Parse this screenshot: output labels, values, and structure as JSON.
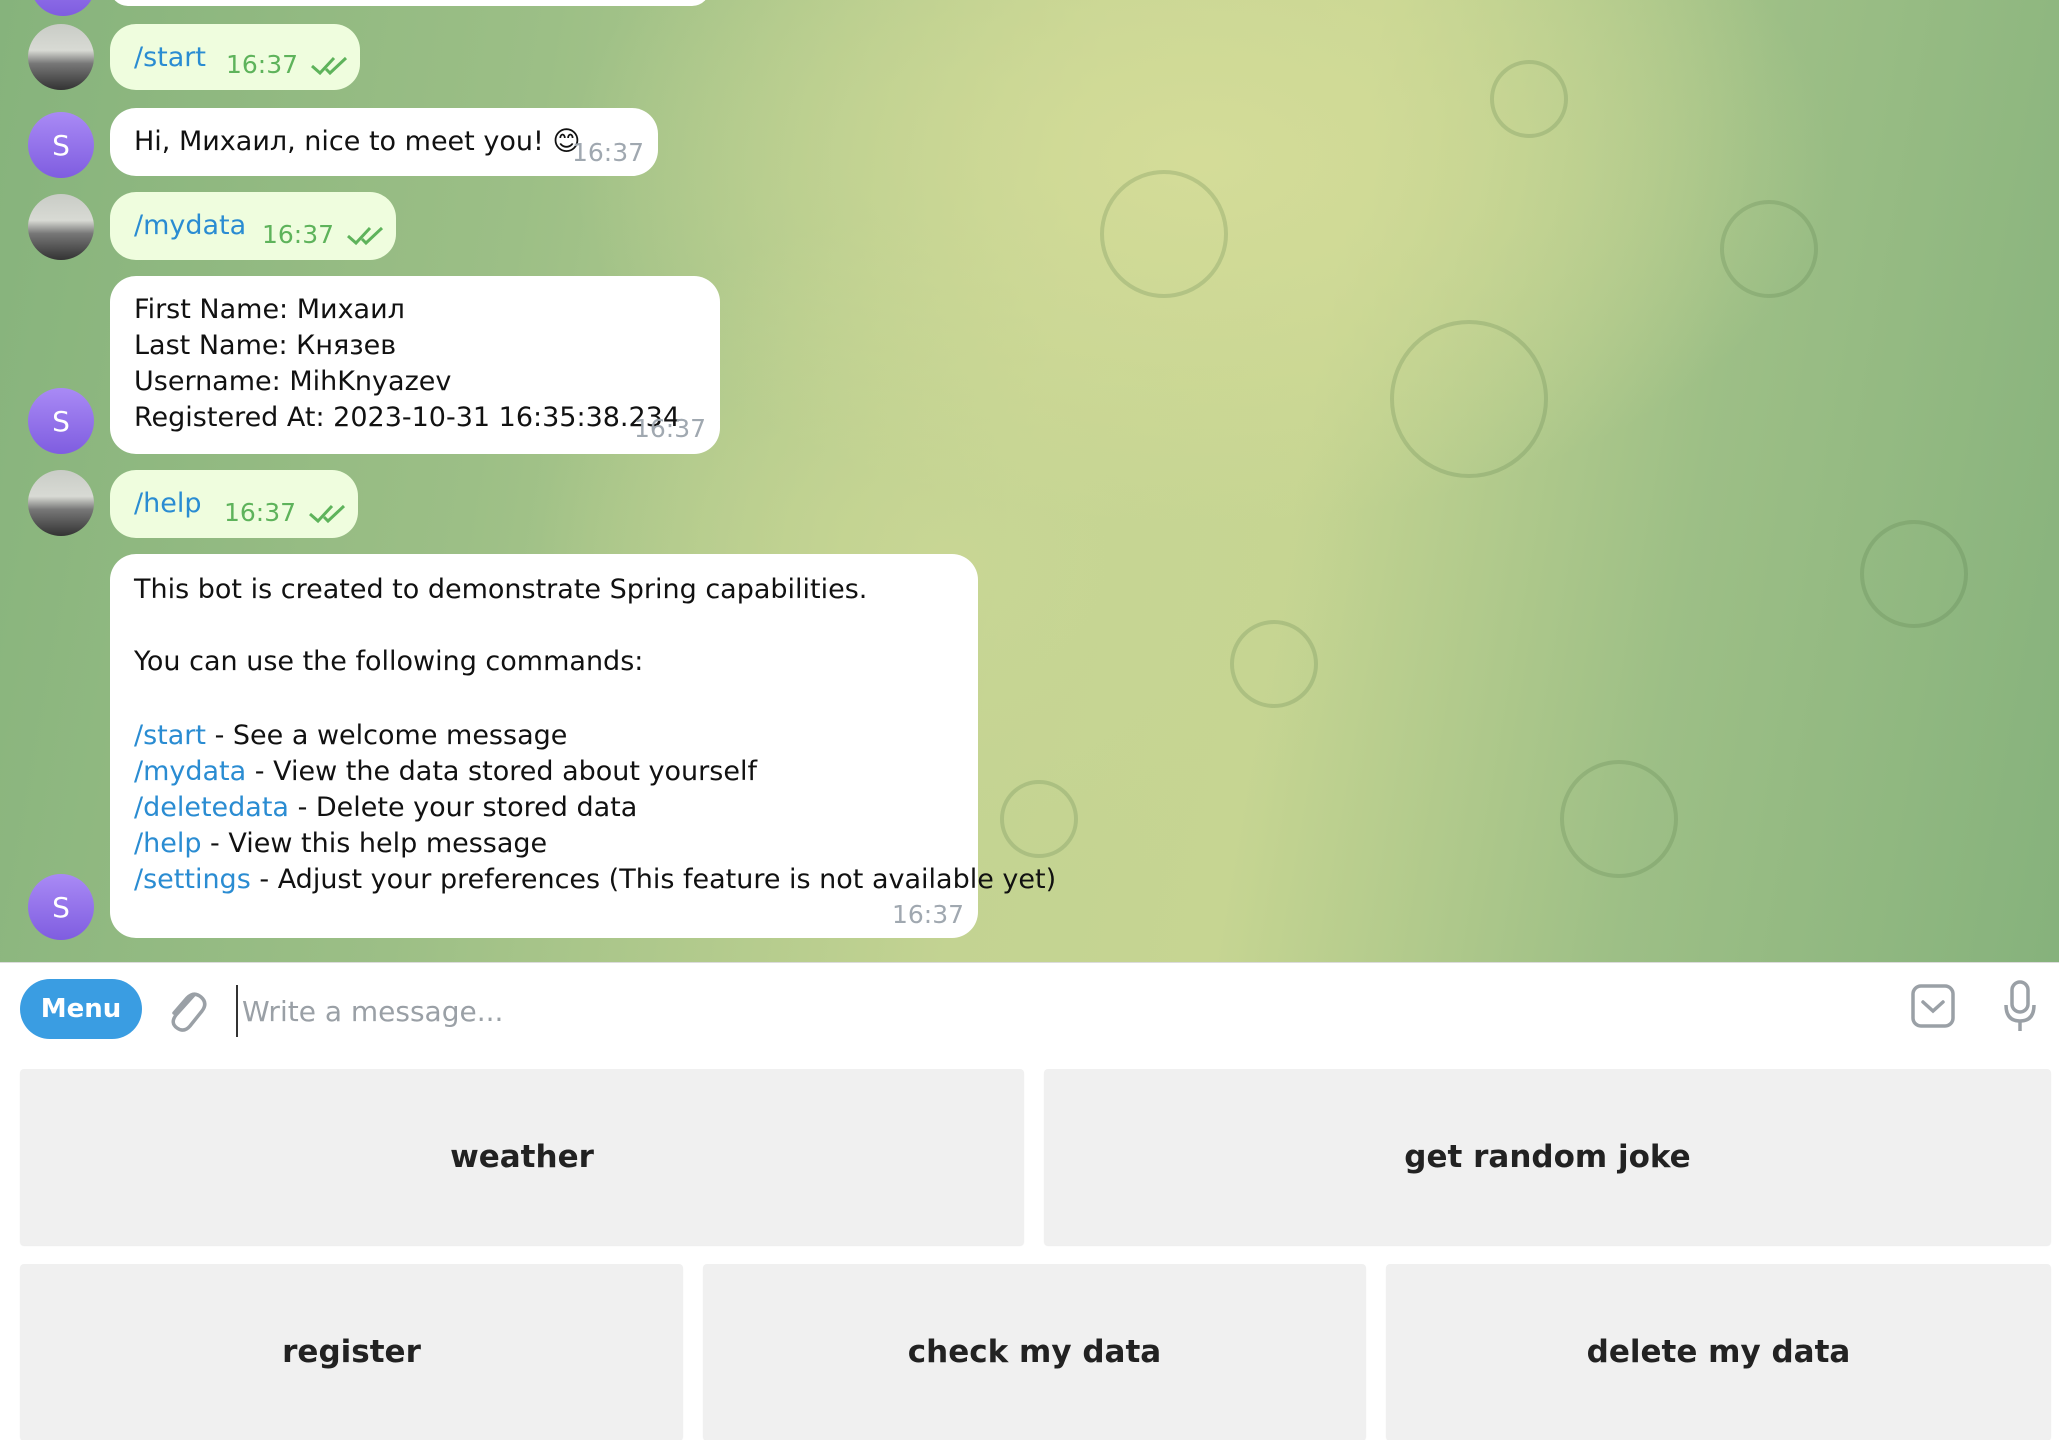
{
  "messages": {
    "m1": {
      "text": "/start",
      "time": "16:37"
    },
    "m2": {
      "text": "Hi, Михаил, nice to meet you! 😊",
      "time": "16:37"
    },
    "m3": {
      "text": "/mydata",
      "time": "16:37"
    },
    "m4": {
      "line1": "First Name: Михаил",
      "line2": "Last Name: Князев",
      "line3": "Username: MihKnyazev",
      "line4": "Registered At: 2023-10-31 16:35:38.234",
      "time": "16:37"
    },
    "m5": {
      "text": "/help",
      "time": "16:37"
    },
    "m6": {
      "intro": "This bot is created to demonstrate Spring capabilities.",
      "intro2": "You can use the following commands:",
      "commands": [
        {
          "cmd": "/start",
          "desc": " - See a welcome message"
        },
        {
          "cmd": "/mydata",
          "desc": " - View the data stored about yourself"
        },
        {
          "cmd": "/deletedata",
          "desc": " - Delete your stored data"
        },
        {
          "cmd": "/help",
          "desc": " - View this help message"
        },
        {
          "cmd": "/settings",
          "desc": " - Adjust your preferences (This feature is not available yet)"
        }
      ],
      "time": "16:37"
    }
  },
  "bot_avatar_letter": "S",
  "composer": {
    "menu_label": "Menu",
    "placeholder": "Write a message..."
  },
  "keyboard": {
    "weather": "weather",
    "joke": "get random joke",
    "register": "register",
    "check": "check my data",
    "delete": "delete my data"
  },
  "colors": {
    "link": "#2a8cd2",
    "outgoing_bubble": "#effdde",
    "read_check": "#5eb35b",
    "menu_button": "#3a9de2",
    "avatar": "#8f6ee8"
  }
}
